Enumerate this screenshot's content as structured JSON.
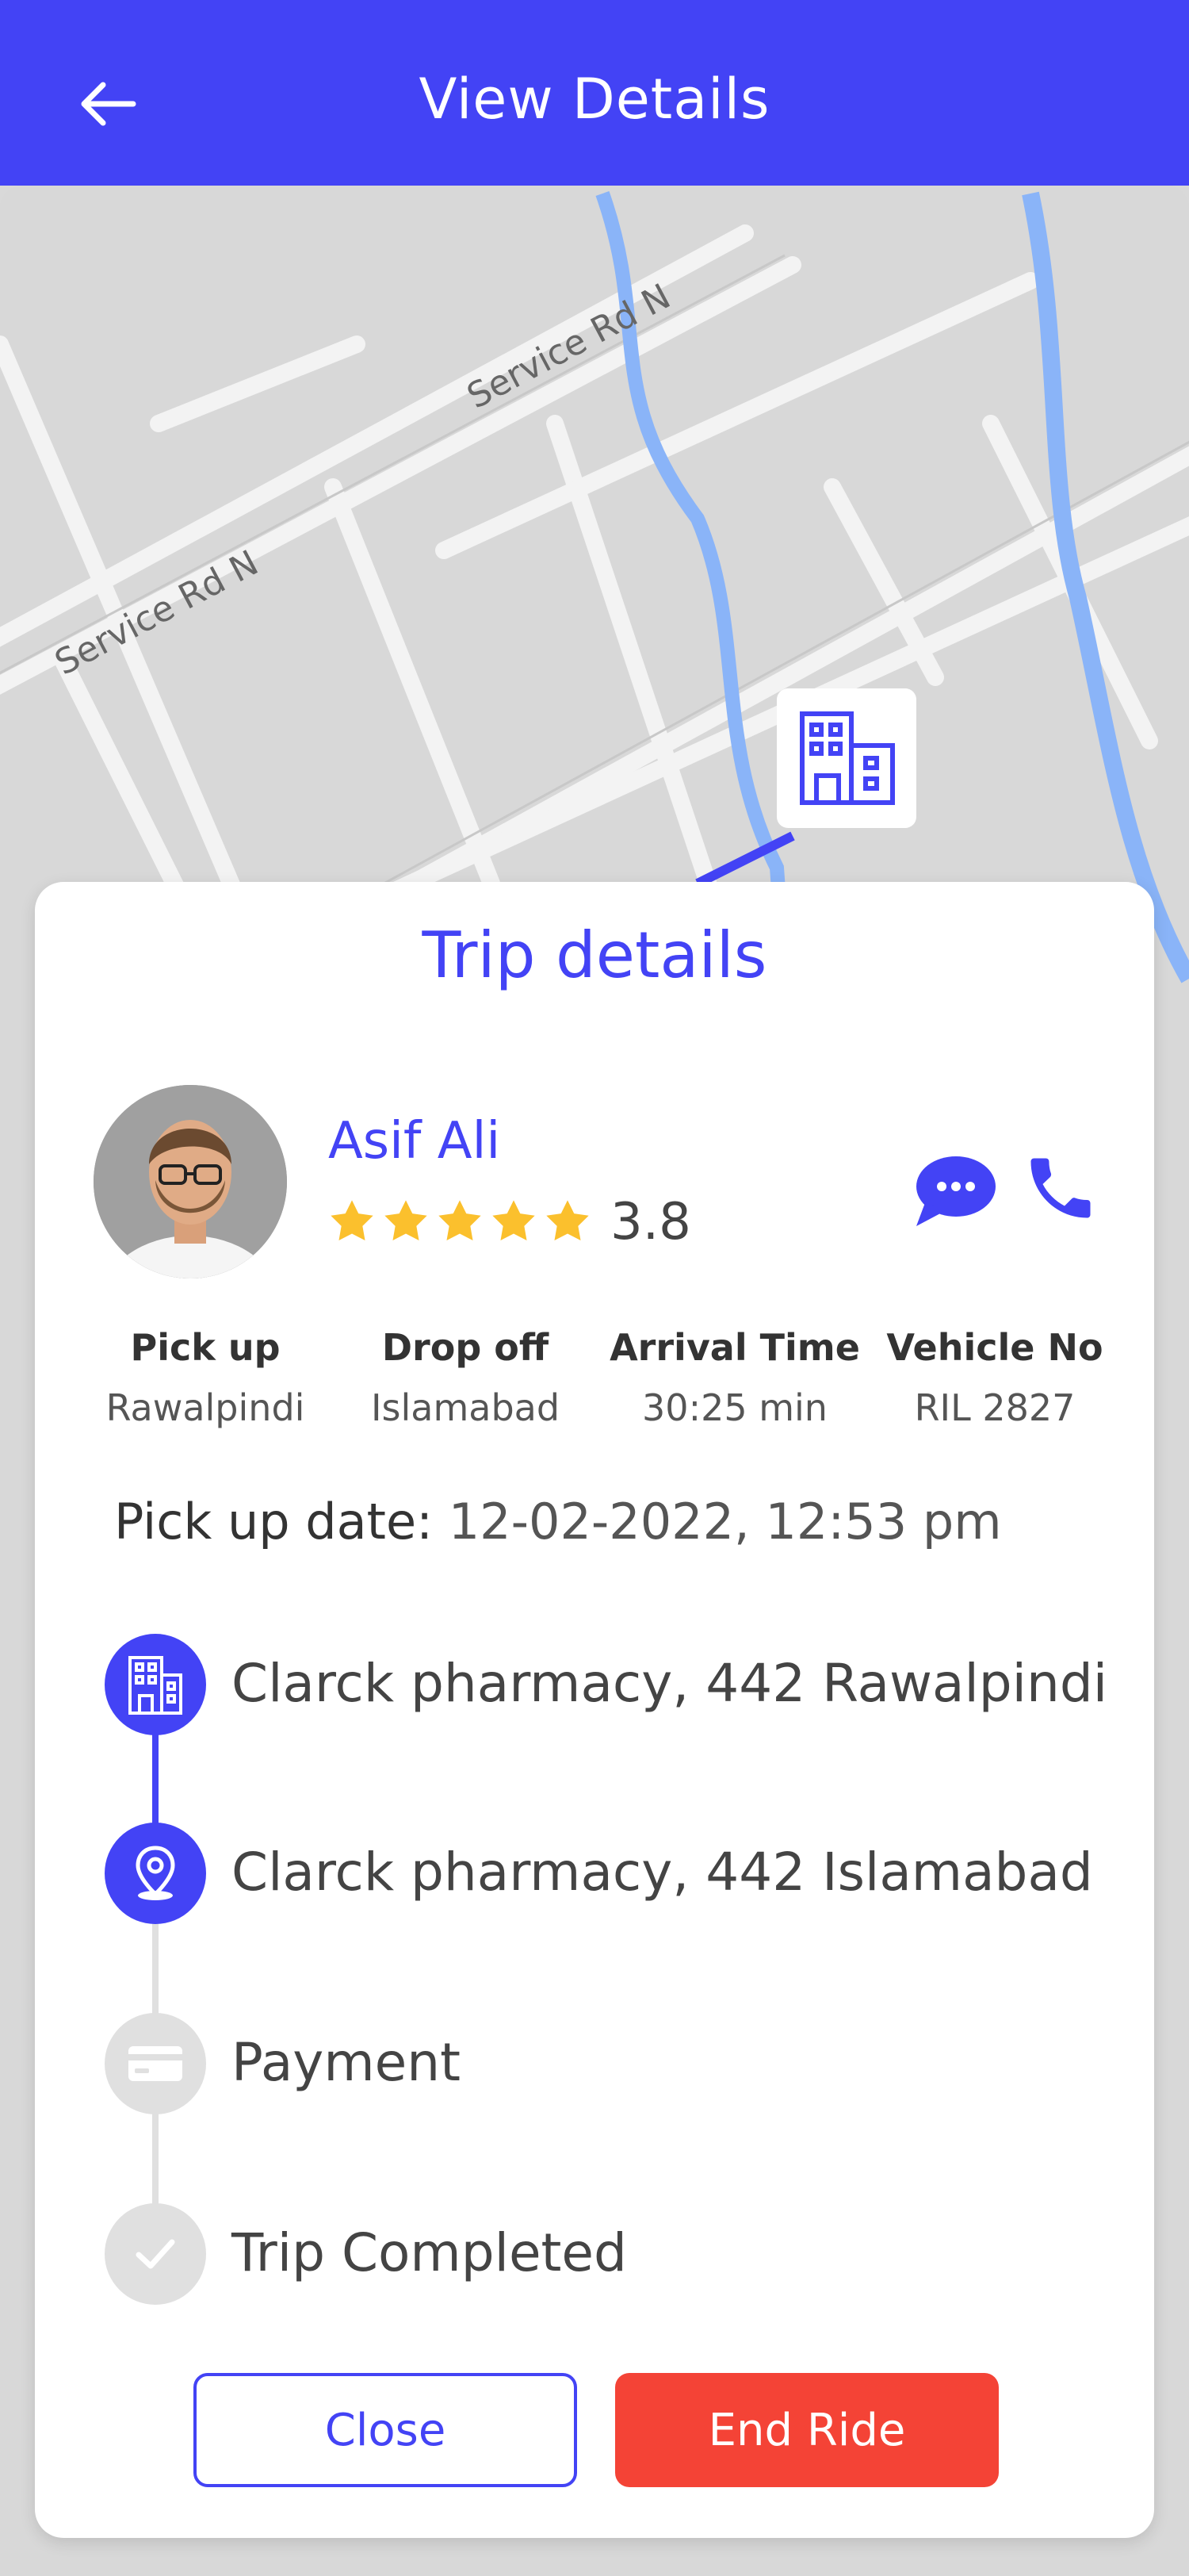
{
  "header": {
    "title": "View Details",
    "back_icon": "arrow-left-icon",
    "background": "#4343f5"
  },
  "map": {
    "street_labels": [
      "Service Rd N",
      "Service Rd N"
    ],
    "marker_icon": "building-icon"
  },
  "trip": {
    "title": "Trip details",
    "driver": {
      "name": "Asif Ali",
      "rating": "3.8",
      "stars": 5
    },
    "actions": {
      "chat_icon": "chat-bubble-icon",
      "call_icon": "phone-icon"
    },
    "info": [
      {
        "label": "Pick up",
        "value": "Rawalpindi"
      },
      {
        "label": "Drop off",
        "value": "Islamabad"
      },
      {
        "label": "Arrival Time",
        "value": "30:25 min"
      },
      {
        "label": "Vehicle No",
        "value": "RIL 2827"
      }
    ],
    "pickup_date": {
      "label": "Pick up date:",
      "value": "12-02-2022, 12:53 pm"
    },
    "steps": [
      {
        "text": "Clarck pharmacy, 442 Rawalpindi",
        "icon": "building-icon",
        "active": true
      },
      {
        "text": "Clarck pharmacy, 442 Islamabad",
        "icon": "location-pin-icon",
        "active": true
      },
      {
        "text": "Payment",
        "icon": "credit-card-icon",
        "active": false
      },
      {
        "text": "Trip Completed",
        "icon": "checkmark-icon",
        "active": false
      }
    ],
    "buttons": {
      "close": "Close",
      "end_ride": "End Ride"
    }
  },
  "colors": {
    "accent": "#4343f5",
    "danger": "#f44336",
    "star": "#fbc02d",
    "inactive": "#e0e0e0"
  }
}
